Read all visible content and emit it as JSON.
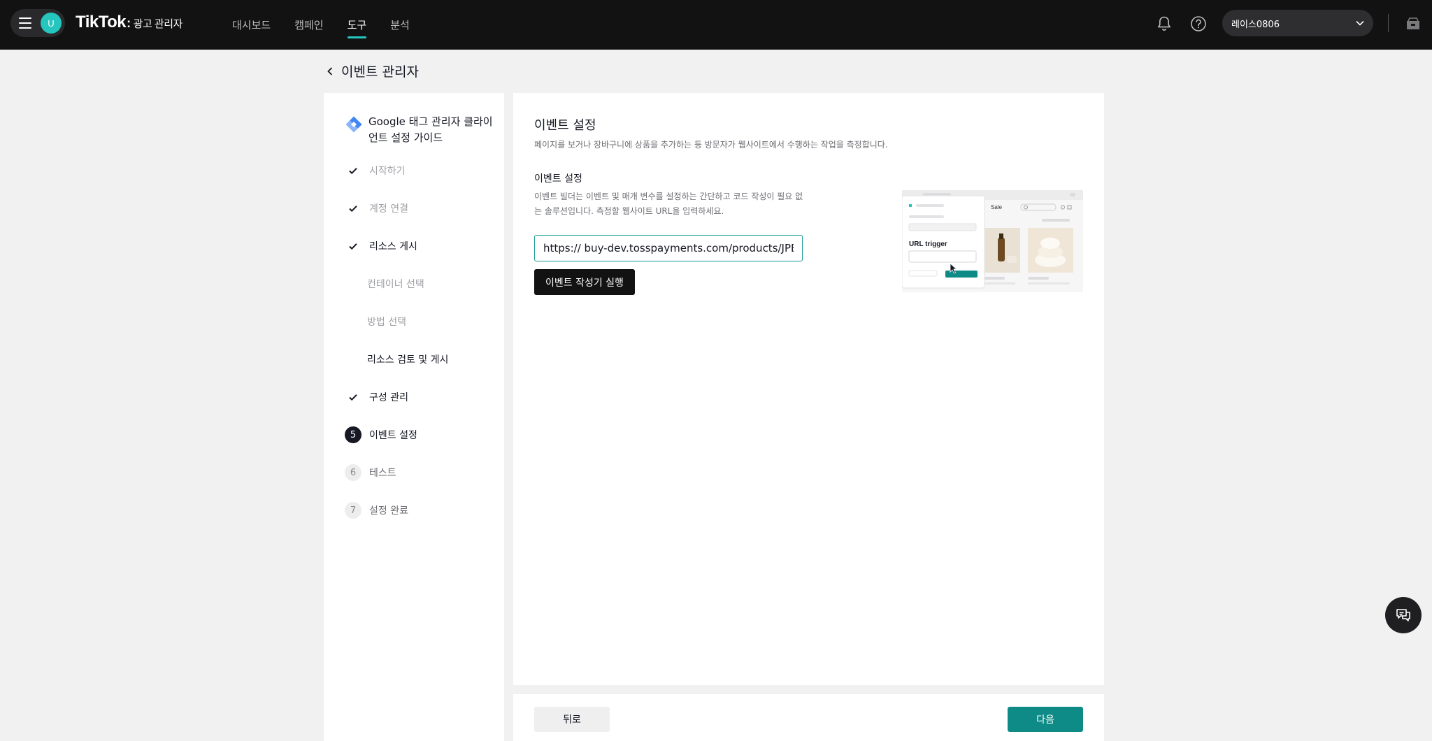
{
  "header": {
    "avatar_initial": "U",
    "logo_text": "TikTok",
    "logo_colon": ":",
    "logo_sub": "광고 관리자",
    "nav": [
      {
        "label": "대시보드",
        "active": false
      },
      {
        "label": "캠페인",
        "active": false
      },
      {
        "label": "도구",
        "active": true
      },
      {
        "label": "분석",
        "active": false
      }
    ],
    "account_name": "레이스0806"
  },
  "page": {
    "back_title": "이벤트 관리자"
  },
  "sidebar": {
    "guide_title": "Google 태그 관리자 클라이언트 설정 가이드",
    "steps": [
      {
        "label": "시작하기",
        "state": "done"
      },
      {
        "label": "계정 연결",
        "state": "done"
      },
      {
        "label": "리소스 게시",
        "state": "done"
      },
      {
        "label": "컨테이너 선택",
        "state": "sub"
      },
      {
        "label": "방법 선택",
        "state": "sub"
      },
      {
        "label": "리소스 검토 및 게시",
        "state": "sub-active"
      },
      {
        "label": "구성 관리",
        "state": "done"
      },
      {
        "label": "이벤트 설정",
        "state": "current",
        "number": "5"
      },
      {
        "label": "테스트",
        "state": "future",
        "number": "6"
      },
      {
        "label": "설정 완료",
        "state": "future",
        "number": "7"
      }
    ]
  },
  "main": {
    "title": "이벤트 설정",
    "description": "페이지를 보거나 장바구니에 상품을 추가하는 등 방문자가 웹사이트에서 수행하는 작업을 측정합니다.",
    "section_title": "이벤트 설정",
    "section_description": "이벤트 빌더는 이벤트 및 매개 변수를 설정하는 간단하고 코드 작성이 필요 없는 솔루션입니다. 측정할 웹사이트 URL을 입력하세요.",
    "url_value": "https:// buy-dev.tosspayments.com/products/JPBm",
    "run_button": "이벤트 작성기 실행",
    "illustration": {
      "sale_label": "Sale",
      "trigger_label": "URL trigger"
    }
  },
  "footer": {
    "back_label": "뒤로",
    "next_label": "다음"
  },
  "colors": {
    "accent": "#0e8b86",
    "brand_teal": "#25c6be",
    "topbar": "#121212"
  }
}
